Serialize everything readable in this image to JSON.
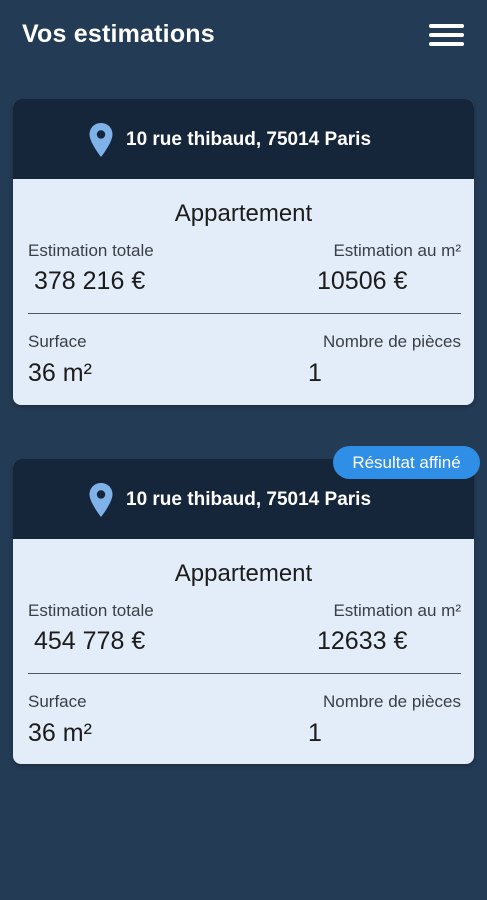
{
  "header": {
    "title": "Vos estimations",
    "menu_icon": "hamburger-menu-icon"
  },
  "colors": {
    "background": "#243b55",
    "card_header": "#15253a",
    "card_body": "#e3edf9",
    "pin": "#7fb2e8",
    "badge": "#2f8ee6"
  },
  "estimations": [
    {
      "address": "10 rue thibaud, 75014 Paris",
      "property_type": "Appartement",
      "total_label": "Estimation totale",
      "total_value": "378 216 €",
      "per_m2_label": "Estimation au m²",
      "per_m2_value": "10506 €",
      "surface_label": "Surface",
      "surface_value": "36 m²",
      "rooms_label": "Nombre de pièces",
      "rooms_value": "1"
    },
    {
      "badge": "Résultat affiné",
      "address": "10 rue thibaud, 75014 Paris",
      "property_type": "Appartement",
      "total_label": "Estimation totale",
      "total_value": "454 778 €",
      "per_m2_label": "Estimation au m²",
      "per_m2_value": "12633 €",
      "surface_label": "Surface",
      "surface_value": "36 m²",
      "rooms_label": "Nombre de pièces",
      "rooms_value": "1"
    }
  ]
}
